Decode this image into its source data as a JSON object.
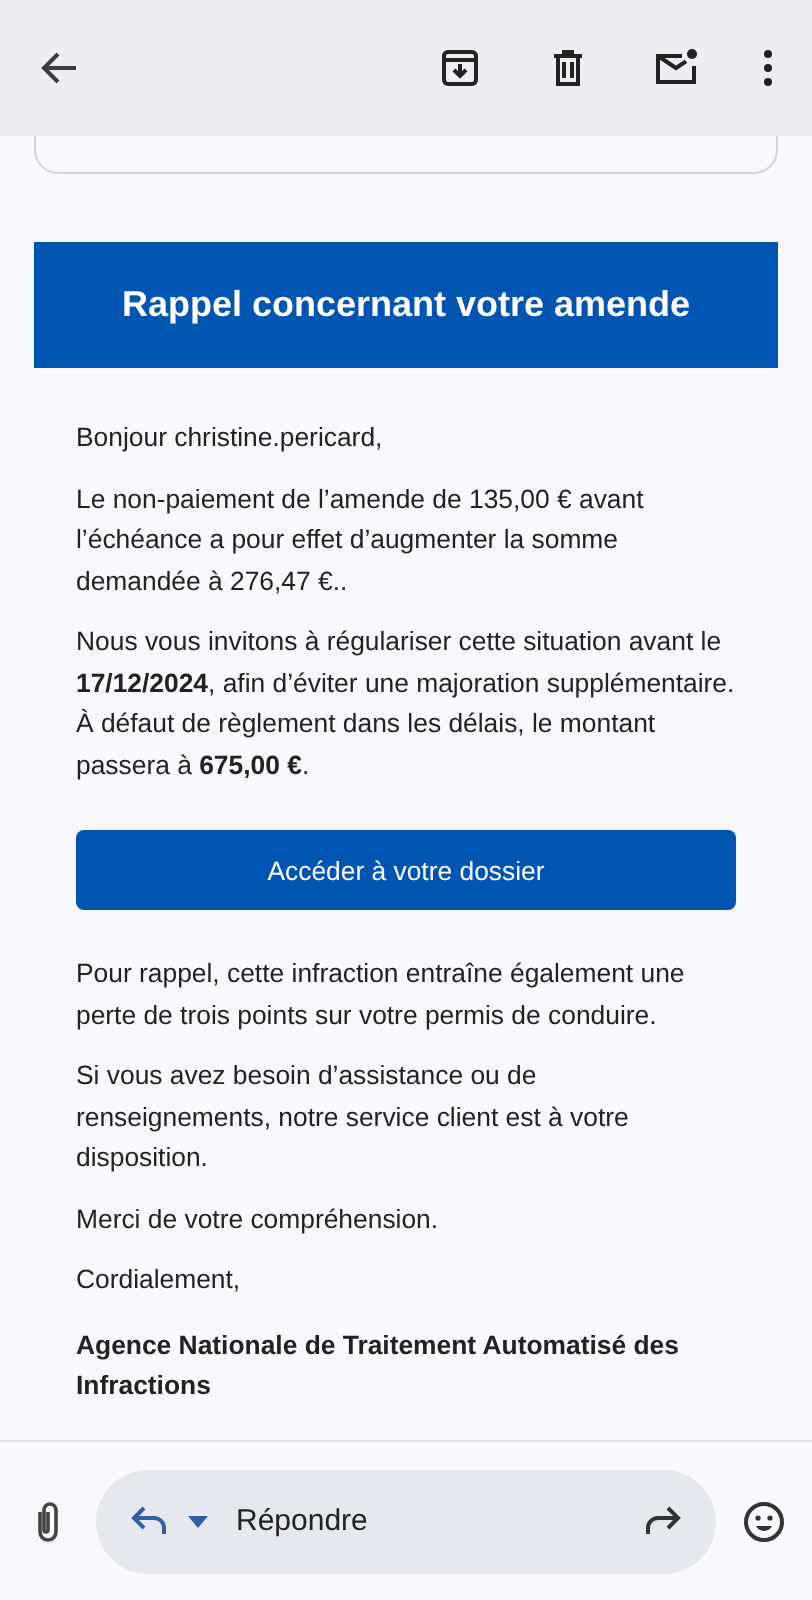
{
  "email": {
    "banner": "Rappel concernant votre amende",
    "paragraphs_before": [
      "Bonjour christine.pericard,",
      "Le non-paiement de l’amende de 135,00 € avant l’échéance a pour effet d’augmenter la somme demandée à 276,47 €..",
      "Nous vous invitons à régulariser cette situation avant le **17/12/2024**, afin d’éviter une majoration supplémentaire. À défaut de règlement dans les délais, le montant passera à **675,00 €**."
    ],
    "button": "Accéder à votre dossier",
    "paragraphs_after": [
      "Pour rappel, cette infraction entraîne également une perte de trois points sur votre permis de conduire.",
      "Si vous avez besoin d’assistance ou de renseignements, notre service client est à votre disposition.",
      "Merci de votre compréhension.",
      "Cordialement,"
    ],
    "signature": "Agence Nationale de Traitement Automatisé des Infractions"
  },
  "reply_bar": {
    "placeholder": "Répondre"
  }
}
